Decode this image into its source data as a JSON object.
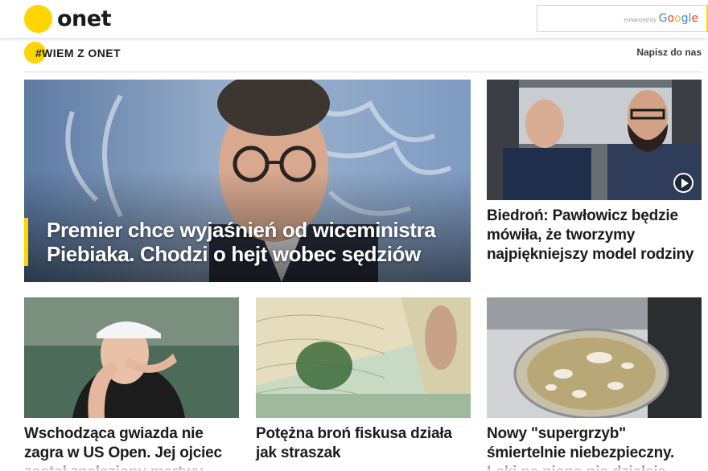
{
  "header": {
    "logo_text": "onet",
    "search": {
      "placeholder": "",
      "enhanced_label": "enhanced by",
      "google_label": "Google"
    }
  },
  "section": {
    "title": "#WIEM Z ONET",
    "link": "Napisz do nas"
  },
  "articles": {
    "hero": {
      "title": "Premier chce wyjaśnień od wiceministra Piebiaka. Chodzi o hejt wobec sędziów"
    },
    "side": {
      "title": "Biedroń: Pawłowicz będzie mówiła, że tworzymy najpiękniejszy model rodziny",
      "icon": "play-icon"
    },
    "row": [
      {
        "title": "Wschodząca gwiazda nie zagra w US Open. Jej ojciec został znaleziony martwy"
      },
      {
        "title": "Potężna broń fiskusa działa jak straszak"
      },
      {
        "title": "Nowy \"supergrzyb\" śmiertelnie niebezpieczny. Leki na niego nie działają"
      }
    ]
  },
  "colors": {
    "accent": "#ffd400",
    "text": "#1b1b1b",
    "divider": "#d9d9d9"
  }
}
